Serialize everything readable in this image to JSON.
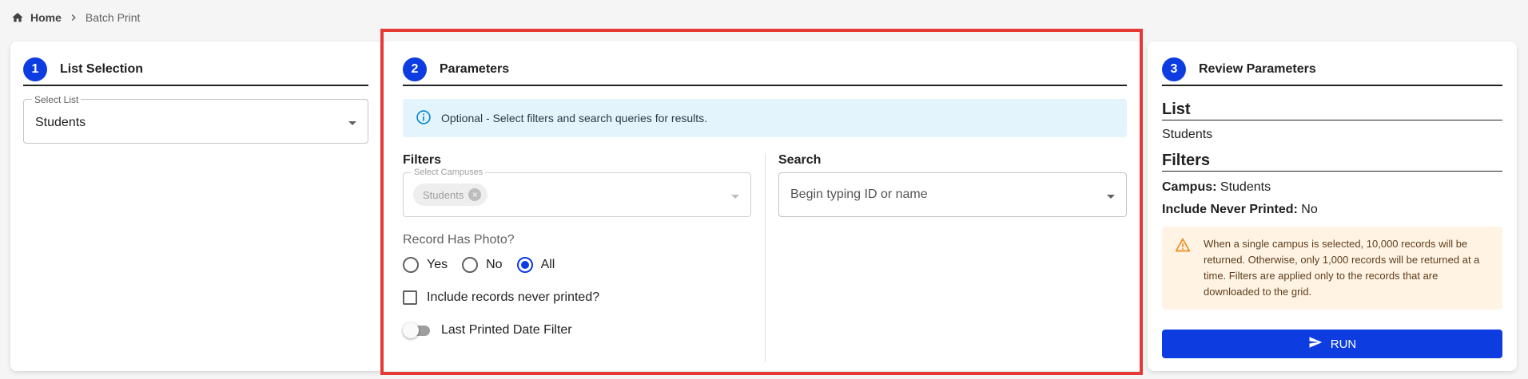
{
  "breadcrumb": {
    "home": "Home",
    "current": "Batch Print",
    "icons": [
      "home-icon",
      "chevron-right-icon"
    ]
  },
  "step1": {
    "number": "1",
    "title": "List Selection",
    "select_list": {
      "label": "Select List",
      "value": "Students"
    }
  },
  "step2": {
    "number": "2",
    "title": "Parameters",
    "info": "Optional - Select filters and search queries for results.",
    "filters_title": "Filters",
    "campuses": {
      "label": "Select Campuses",
      "chip": "Students"
    },
    "search_title": "Search",
    "search_placeholder": "Begin typing ID or name",
    "photo_label": "Record Has Photo?",
    "photo_options": [
      {
        "label": "Yes",
        "checked": false
      },
      {
        "label": "No",
        "checked": false
      },
      {
        "label": "All",
        "checked": true
      }
    ],
    "never_printed_label": "Include records never printed?",
    "never_printed_checked": false,
    "date_filter_label": "Last Printed Date Filter",
    "date_filter_on": false
  },
  "step3": {
    "number": "3",
    "title": "Review Parameters",
    "list_heading": "List",
    "list_value": "Students",
    "filters_heading": "Filters",
    "campus_label": "Campus:",
    "campus_value": "Students",
    "never_label": "Include Never Printed:",
    "never_value": "No",
    "warning": "When a single campus is selected, 10,000 records will be returned. Otherwise, only 1,000 records will be returned at a time. Filters are applied only to the records that are downloaded to the grid.",
    "run_label": "RUN"
  },
  "colors": {
    "accent": "#0d3de0",
    "highlight": "#e53935",
    "info_bg": "#e3f4fc",
    "warning_bg": "#fff3e3",
    "warning_icon": "#ef8a1b",
    "info_icon": "#0288d1"
  }
}
